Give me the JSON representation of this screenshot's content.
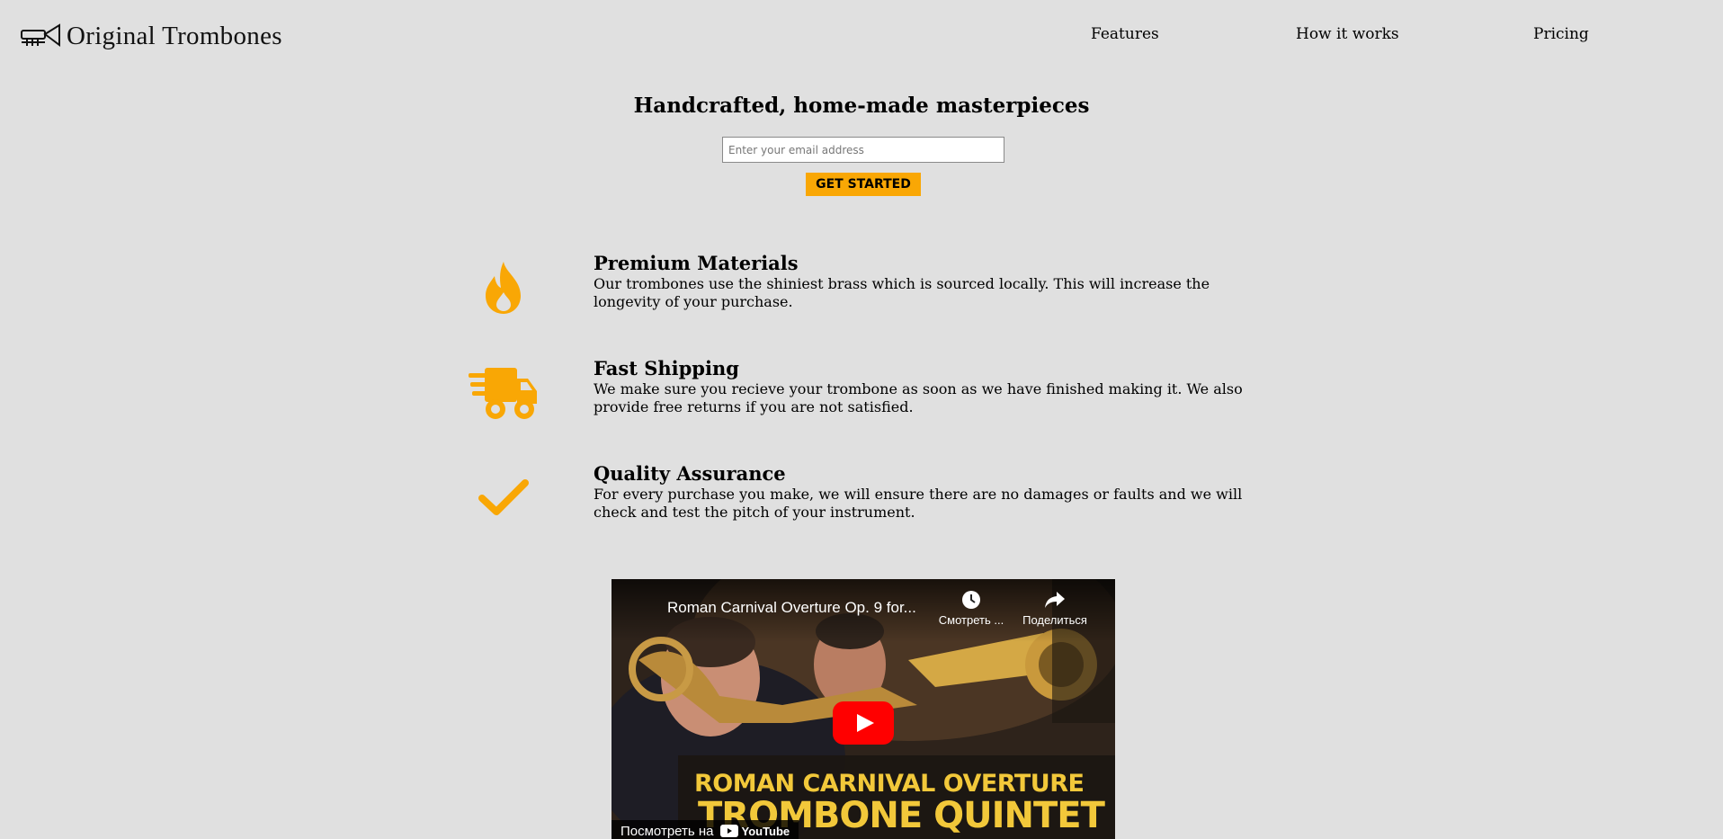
{
  "header": {
    "logo_text": "Original Trombones",
    "nav": [
      {
        "label": "Features"
      },
      {
        "label": "How it works"
      },
      {
        "label": "Pricing"
      }
    ]
  },
  "hero": {
    "title": "Handcrafted, home-made masterpieces",
    "email_placeholder": "Enter your email address",
    "email_value": "",
    "cta_label": "GET STARTED"
  },
  "features": [
    {
      "icon": "fire-icon",
      "heading": "Premium Materials",
      "description": "Our trombones use the shiniest brass which is sourced locally. This will increase the longevity of your purchase."
    },
    {
      "icon": "truck-icon",
      "heading": "Fast Shipping",
      "description": "We make sure you recieve your trombone as soon as we have finished making it. We also provide free returns if you are not satisfied."
    },
    {
      "icon": "check-icon",
      "heading": "Quality Assurance",
      "description": "For every purchase you make, we will ensure there are no damages or faults and we will check and test the pitch of your instrument."
    }
  ],
  "video": {
    "title": "Roman Carnival Overture Op. 9 for...",
    "watch_later_label": "Смотреть ...",
    "share_label": "Поделиться",
    "banner_line1": "ROMAN CARNIVAL OVERTURE",
    "banner_line2": "TROMBONE QUINTET",
    "watch_on_label": "Посмотреть на",
    "platform_label": "YouTube"
  },
  "colors": {
    "accent": "#f9a705",
    "background": "#e0e0e0",
    "youtube_red": "#ff0000",
    "banner_text": "#f2c83a"
  }
}
